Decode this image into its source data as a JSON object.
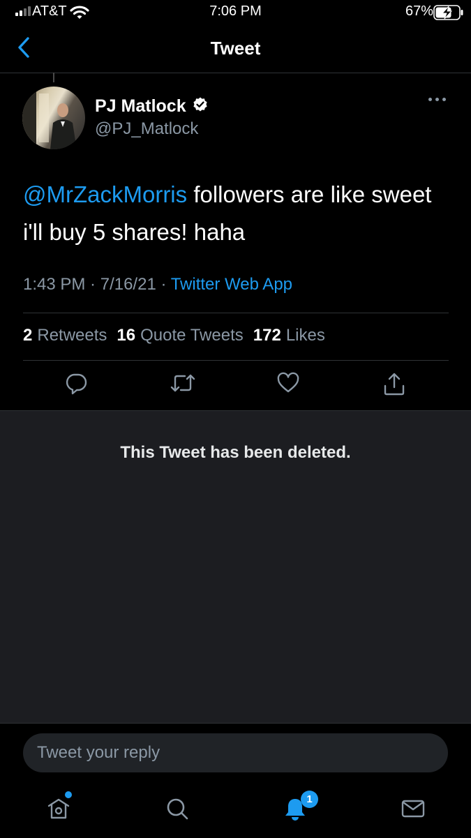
{
  "status_bar": {
    "carrier": "AT&T",
    "time": "7:06 PM",
    "battery": "67%"
  },
  "nav": {
    "title": "Tweet",
    "back_icon": "chevron-left-icon"
  },
  "tweet": {
    "author_name": "PJ Matlock",
    "author_handle": "@PJ_Matlock",
    "verified": true,
    "mention": "@MrZackMorris",
    "text": " followers are like sweet i'll buy 5 shares! haha",
    "time": "1:43 PM",
    "date": "7/16/21",
    "source": "Twitter Web App",
    "separator": " · ",
    "stats": [
      {
        "count": "2",
        "label": "Retweets"
      },
      {
        "count": "16",
        "label": "Quote Tweets"
      },
      {
        "count": "172",
        "label": "Likes"
      }
    ],
    "actions": [
      "reply-icon",
      "retweet-icon",
      "like-icon",
      "share-icon"
    ]
  },
  "quoted": {
    "deleted_message": "This Tweet has been deleted."
  },
  "reply": {
    "placeholder": "Tweet your reply"
  },
  "tab_bar": {
    "tabs": [
      "home-icon",
      "search-icon",
      "notifications-icon",
      "messages-icon"
    ],
    "notification_count": "1"
  },
  "colors": {
    "accent": "#1d9bf0",
    "secondary_text": "#8b98a5",
    "background": "#000000",
    "panel": "#1c1d21"
  }
}
